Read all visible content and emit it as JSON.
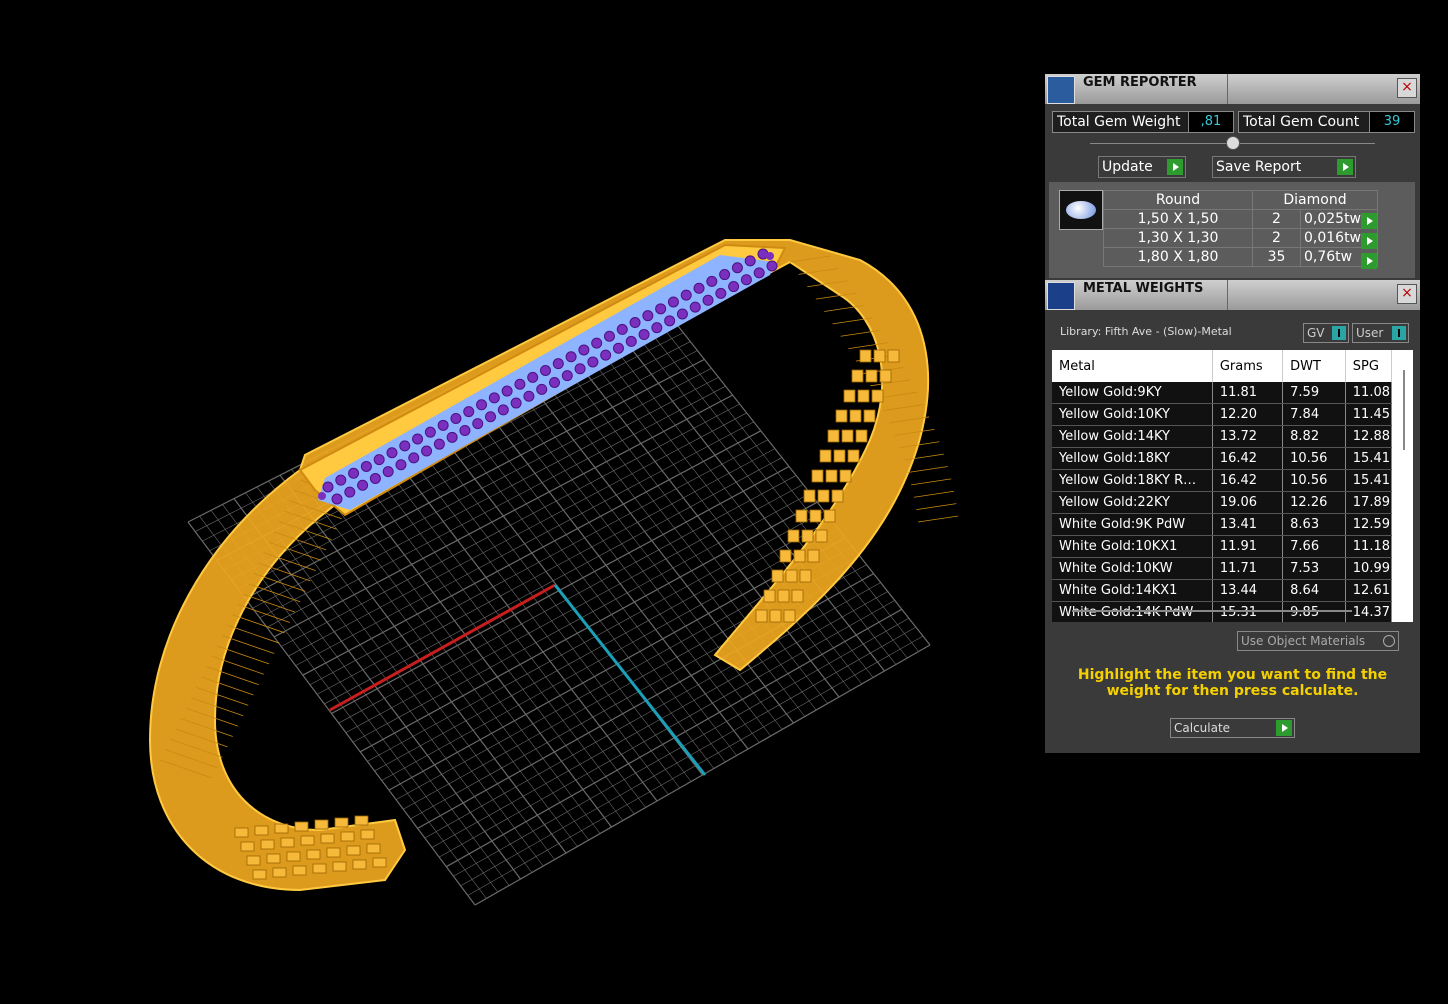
{
  "gem_reporter": {
    "title": "GEM REPORTER",
    "close_symbol": "×",
    "total_gem_weight_label": "Total Gem Weight",
    "total_gem_weight_value": ",81",
    "total_gem_count_label": "Total Gem Count",
    "total_gem_count_value": "39",
    "update_label": "Update",
    "save_report_label": "Save Report",
    "header_shape": "Round",
    "header_type": "Diamond",
    "rows": [
      {
        "size": "1,50 X 1,50",
        "count": "2",
        "weight": "0,025tw"
      },
      {
        "size": "1,30 X 1,30",
        "count": "2",
        "weight": "0,016tw"
      },
      {
        "size": "1,80 X 1,80",
        "count": "35",
        "weight": "0,76tw"
      }
    ]
  },
  "metal_weights": {
    "title": "METAL WEIGHTS",
    "close_symbol": "×",
    "library": "Library: Fifth Ave - (Slow)-Metal",
    "gv_label": "GV",
    "user_label": "User",
    "columns": [
      "Metal",
      "Grams",
      "DWT",
      "SPG"
    ],
    "rows": [
      [
        "Yellow Gold:9KY",
        "11.81",
        "7.59",
        "11.08"
      ],
      [
        "Yellow Gold:10KY",
        "12.20",
        "7.84",
        "11.45"
      ],
      [
        "Yellow Gold:14KY",
        "13.72",
        "8.82",
        "12.88"
      ],
      [
        "Yellow Gold:18KY",
        "16.42",
        "10.56",
        "15.41"
      ],
      [
        "Yellow Gold:18KY R…",
        "16.42",
        "10.56",
        "15.41"
      ],
      [
        "Yellow Gold:22KY",
        "19.06",
        "12.26",
        "17.89"
      ],
      [
        "White Gold:9K PdW",
        "13.41",
        "8.63",
        "12.59"
      ],
      [
        "White Gold:10KX1",
        "11.91",
        "7.66",
        "11.18"
      ],
      [
        "White Gold:10KW",
        "11.71",
        "7.53",
        "10.99"
      ],
      [
        "White Gold:14KX1",
        "13.44",
        "8.64",
        "12.61"
      ],
      [
        "White Gold:14K PdW",
        "15.31",
        "9.85",
        "14.37"
      ]
    ],
    "use_object_materials": "Use Object Materials",
    "hint": "Highlight the item you want to find the weight for then press calculate.",
    "calculate_label": "Calculate"
  },
  "colors": {
    "metal": "#f0a820",
    "gem_purple": "#7b2fbf",
    "seat_blue": "#8fb4ff",
    "axis_red": "#c81e1e",
    "axis_cyan": "#1aa0b8"
  }
}
